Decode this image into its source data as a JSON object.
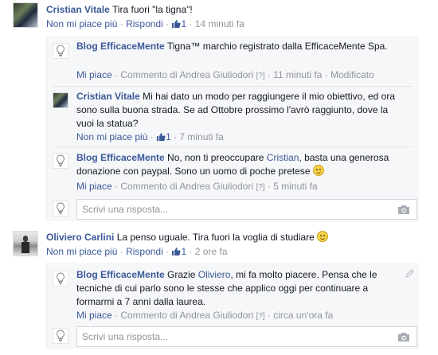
{
  "colors": {
    "link": "#3b5998",
    "meta": "#90949c",
    "panel_bg": "#f6f7f9"
  },
  "c1": {
    "author": "Cristian Vitale",
    "text": "Tira fuori \"la tigna\"!",
    "unlike": "Non mi piace più",
    "reply": "Rispondi",
    "likes": "1",
    "time": "14 minuti fa"
  },
  "r1": {
    "author": "Blog EfficaceMente",
    "text": "Tigna™ marchio registrato dalla EfficaceMente Spa.",
    "like": "Mi piace",
    "by": "Commento di Andrea Giuliodori",
    "hint": "[?]",
    "time": "11 minuti fa",
    "edited": "Modificato"
  },
  "r2": {
    "author": "Cristian Vitale",
    "text": "Mi hai dato un modo per raggiungere il mio obiettivo, ed ora sono sulla buona strada. Se ad Ottobre prossimo l'avrò raggiunto, dove la vuoi la statua?",
    "unlike": "Non mi piace più",
    "likes": "1",
    "time": "7 minuti fa"
  },
  "r3": {
    "author": "Blog EfficaceMente",
    "text_a": "No, non ti preoccupare ",
    "mention": "Cristian",
    "text_b": ", basta una generosa donazione con paypal. Sono un uomo di poche pretese",
    "like": "Mi piace",
    "by": "Commento di Andrea Giuliodori",
    "hint": "[?]",
    "time": "5 minuti fa"
  },
  "reply_box_1": {
    "placeholder": "Scrivi una risposta..."
  },
  "c2": {
    "author": "Oliviero Carlini",
    "text": "La penso uguale. Tira fuori la voglia di studiare",
    "unlike": "Non mi piace più",
    "reply": "Rispondi",
    "likes": "1",
    "time": "2 ore fa"
  },
  "r4": {
    "author": "Blog EfficaceMente",
    "text_a": "Grazie ",
    "mention": "Oliviero",
    "text_b": ", mi fa molto piacere. Pensa che le tecniche di cui parlo sono le stesse che applico oggi per continuare a formarmi a 7 anni dalla laurea.",
    "like": "Mi piace",
    "by": "Commento di Andrea Giuliodori",
    "hint": "[?]",
    "time": "circa un'ora fa"
  },
  "reply_box_2": {
    "placeholder": "Scrivi una risposta..."
  }
}
